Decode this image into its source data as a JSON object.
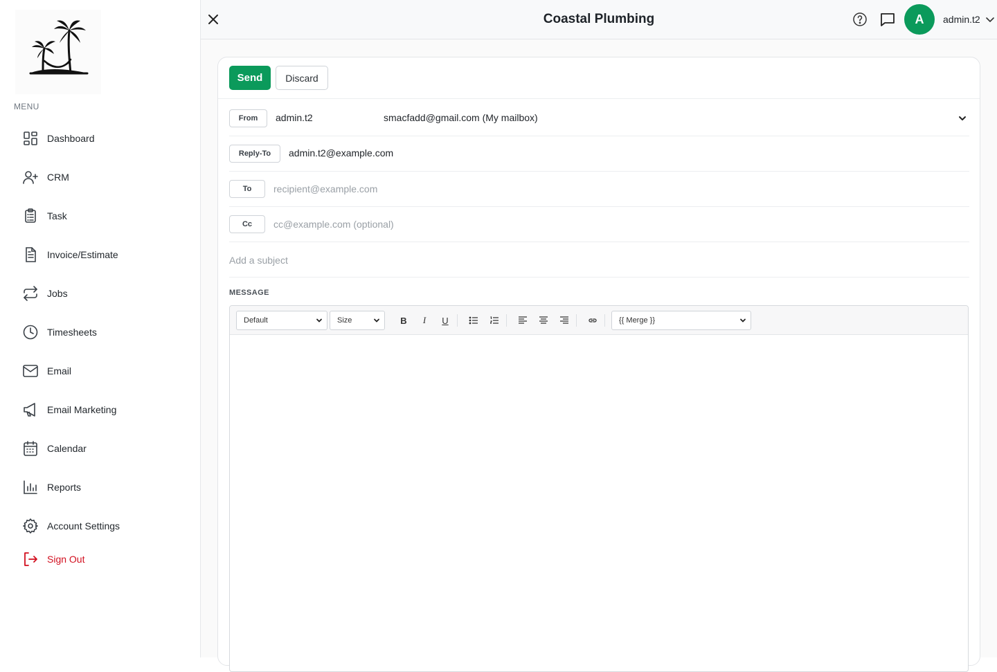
{
  "app": {
    "title": "Coastal Plumbing"
  },
  "user": {
    "name": "admin.t2",
    "avatar_initial": "A"
  },
  "sidebar": {
    "menu_label": "MENU",
    "items": [
      {
        "label": "Dashboard",
        "icon": "dashboard-icon"
      },
      {
        "label": "CRM",
        "icon": "user-plus-icon"
      },
      {
        "label": "Task",
        "icon": "clipboard-icon"
      },
      {
        "label": "Invoice/Estimate",
        "icon": "document-icon"
      },
      {
        "label": "Jobs",
        "icon": "repeat-icon"
      },
      {
        "label": "Timesheets",
        "icon": "clock-icon"
      },
      {
        "label": "Email",
        "icon": "mail-icon"
      },
      {
        "label": "Email Marketing",
        "icon": "megaphone-icon"
      },
      {
        "label": "Calendar",
        "icon": "calendar-icon"
      },
      {
        "label": "Reports",
        "icon": "bar-chart-icon"
      },
      {
        "label": "Account Settings",
        "icon": "gear-icon"
      }
    ],
    "sign_out": {
      "label": "Sign Out",
      "icon": "sign-out-icon",
      "color": "#d20f1f"
    }
  },
  "composer": {
    "send_label": "Send",
    "discard_label": "Discard",
    "from": {
      "tag": "From",
      "name": "admin.t2",
      "mailbox": "smacfadd@gmail.com (My mailbox)"
    },
    "reply_to": {
      "tag": "Reply-To",
      "value": "admin.t2@example.com"
    },
    "to": {
      "tag": "To",
      "placeholder": "recipient@example.com",
      "value": ""
    },
    "cc": {
      "tag": "Cc",
      "placeholder": "cc@example.com (optional)",
      "value": ""
    },
    "subject": {
      "placeholder": "Add a subject",
      "value": ""
    },
    "message_label": "MESSAGE",
    "toolbar": {
      "font_select": "Default",
      "size_select": "Size",
      "bold": "B",
      "italic": "I",
      "underline": "U",
      "merge_select": "{{ Merge }}"
    }
  },
  "colors": {
    "brand": "#0b9a5b",
    "danger": "#d20f1f"
  }
}
